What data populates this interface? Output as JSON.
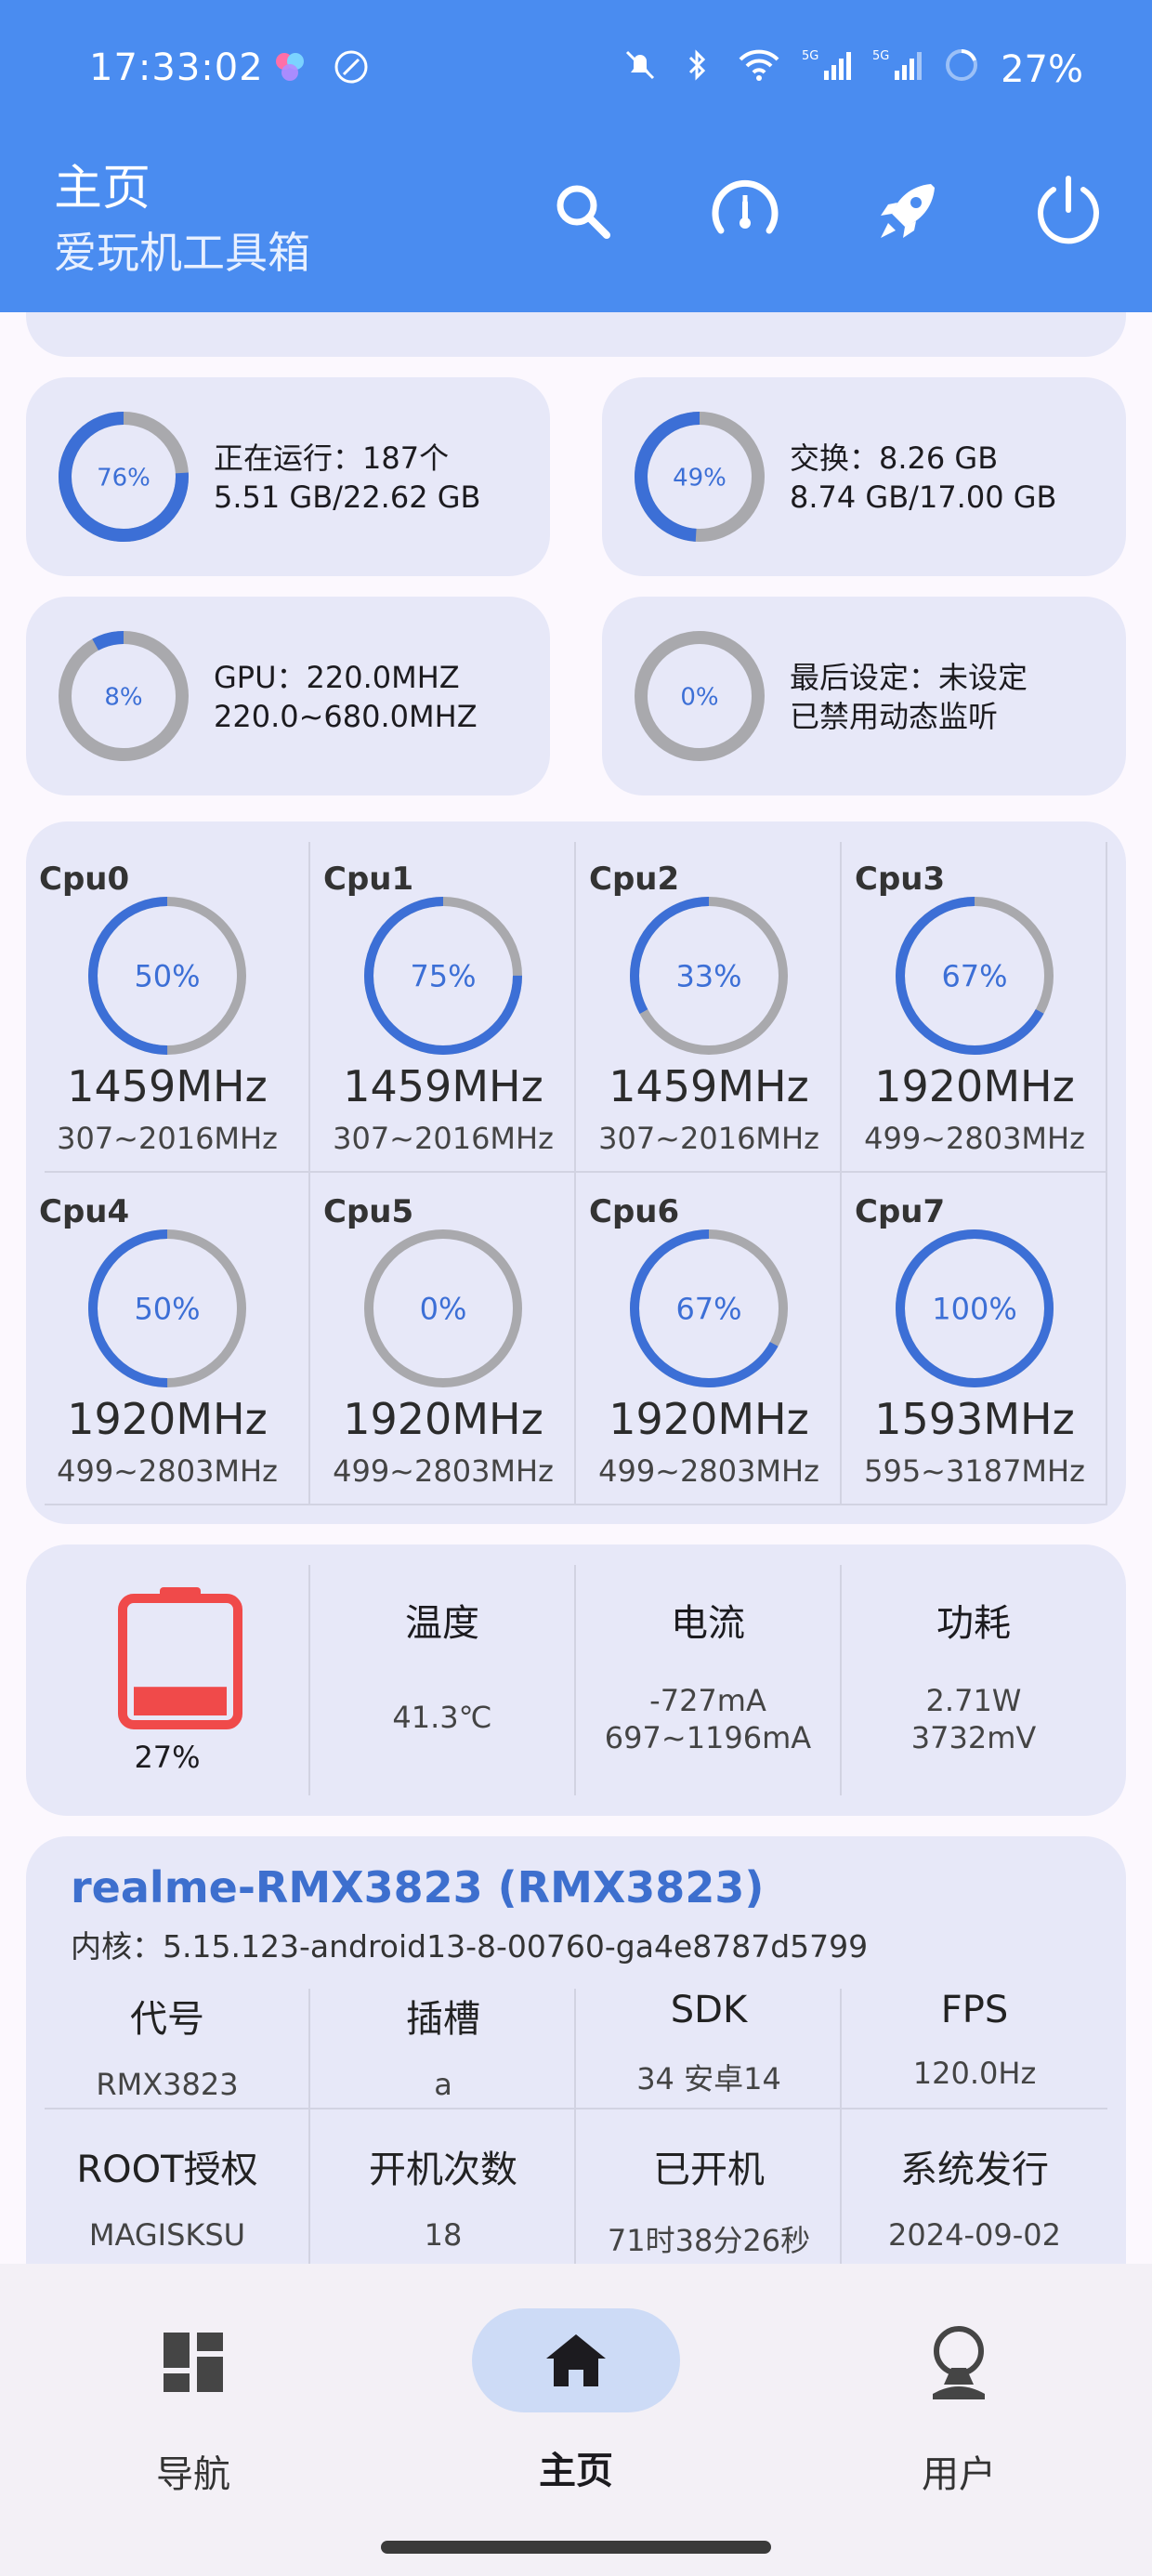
{
  "status": {
    "time": "17:33:02",
    "battery": "27%"
  },
  "header": {
    "title": "主页",
    "subtitle": "爱玩机工具箱"
  },
  "mini_cards": [
    {
      "pct": 76,
      "pct_label": "76%",
      "line1": "正在运行：187个",
      "line2": "5.51 GB/22.62 GB"
    },
    {
      "pct": 49,
      "pct_label": "49%",
      "line1": "交换：8.26 GB",
      "line2": "8.74 GB/17.00 GB"
    },
    {
      "pct": 8,
      "pct_label": "8%",
      "line1": "GPU：220.0MHZ",
      "line2": "220.0~680.0MHZ"
    },
    {
      "pct": 0,
      "pct_label": "0%",
      "line1": "最后设定：未设定",
      "line2": "已禁用动态监听"
    }
  ],
  "cpus": [
    {
      "name": "Cpu0",
      "pct": 50,
      "pct_label": "50%",
      "freq": "1459MHz",
      "range": "307~2016MHz"
    },
    {
      "name": "Cpu1",
      "pct": 75,
      "pct_label": "75%",
      "freq": "1459MHz",
      "range": "307~2016MHz"
    },
    {
      "name": "Cpu2",
      "pct": 33,
      "pct_label": "33%",
      "freq": "1459MHz",
      "range": "307~2016MHz"
    },
    {
      "name": "Cpu3",
      "pct": 67,
      "pct_label": "67%",
      "freq": "1920MHz",
      "range": "499~2803MHz"
    },
    {
      "name": "Cpu4",
      "pct": 50,
      "pct_label": "50%",
      "freq": "1920MHz",
      "range": "499~2803MHz"
    },
    {
      "name": "Cpu5",
      "pct": 0,
      "pct_label": "0%",
      "freq": "1920MHz",
      "range": "499~2803MHz"
    },
    {
      "name": "Cpu6",
      "pct": 67,
      "pct_label": "67%",
      "freq": "1920MHz",
      "range": "499~2803MHz"
    },
    {
      "name": "Cpu7",
      "pct": 100,
      "pct_label": "100%",
      "freq": "1593MHz",
      "range": "595~3187MHz"
    }
  ],
  "battery": {
    "level": 0.27,
    "level_label": "27%",
    "temp_label": "温度",
    "temp_value": "41.3℃",
    "current_label": "电流",
    "current_value": "-727mA",
    "current_range": "697~1196mA",
    "power_label": "功耗",
    "power_value": "2.71W",
    "voltage": "3732mV"
  },
  "device": {
    "name": "realme-RMX3823 (RMX3823)",
    "kernel": "内核：5.15.123-android13-8-00760-ga4e8787d5799",
    "fields": [
      {
        "k": "代号",
        "v": "RMX3823"
      },
      {
        "k": "插槽",
        "v": "a"
      },
      {
        "k": "SDK",
        "v": "34  安卓14"
      },
      {
        "k": "FPS",
        "v": "120.0Hz"
      },
      {
        "k": "ROOT授权",
        "v": "MAGISKSU"
      },
      {
        "k": "开机次数",
        "v": "18"
      },
      {
        "k": "已开机",
        "v": "71时38分26秒"
      },
      {
        "k": "系统发行",
        "v": "2024-09-02"
      }
    ]
  },
  "nav": {
    "items": [
      {
        "label": "导航"
      },
      {
        "label": "主页"
      },
      {
        "label": "用户"
      }
    ]
  },
  "colors": {
    "primary": "#4a8cf0",
    "ring_fill": "#3c6fd6",
    "ring_track": "#a9a9ad",
    "battery_red": "#f04a4a",
    "card": "#e7e8f8"
  }
}
